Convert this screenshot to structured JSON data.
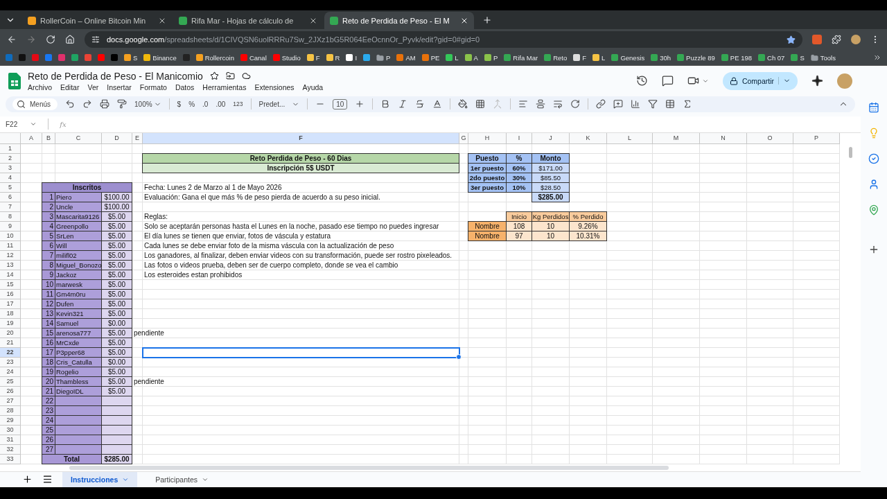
{
  "browser": {
    "tabs": [
      {
        "title": "RollerCoin – Online Bitcoin Min",
        "color": "#f4a020",
        "selected": false
      },
      {
        "title": "Rifa Mar - Hojas de cálculo de",
        "color": "#34a853",
        "selected": false
      },
      {
        "title": "Reto de Perdida de Peso - El M",
        "color": "#34a853",
        "selected": true
      }
    ],
    "url_host": "docs.google.com",
    "url_path": "/spreadsheets/d/1CIVQSN6uolRRRu7Sw_2JXz1bG5R064EeOcnnOr_Pyvk/edit?gid=0#gid=0",
    "bookmarks": [
      {
        "color": "#0f6cbd"
      },
      {
        "color": "#111111"
      },
      {
        "color": "#e50914"
      },
      {
        "color": "#1877f2"
      },
      {
        "color": "#e1306c"
      },
      {
        "color": "#1fa463"
      },
      {
        "color": "#ea4335"
      },
      {
        "color": "#ff0000"
      },
      {
        "color": "#000000"
      },
      {
        "label": "S",
        "color": "#f4a020"
      },
      {
        "label": "Binance",
        "color": "#f0b90b"
      },
      {
        "color": "#222222"
      },
      {
        "label": "Rollercoin",
        "color": "#f4a020"
      },
      {
        "label": "Canal",
        "color": "#ff0000"
      },
      {
        "label": "Studio",
        "color": "#ff0000"
      },
      {
        "label": "F",
        "color": "#f6c344"
      },
      {
        "label": "R",
        "color": "#f6c344"
      },
      {
        "label": "I",
        "color": "#ffffff"
      },
      {
        "color": "#2aabee"
      },
      {
        "label": "P",
        "color": "#9aa0a6",
        "kind": "folder"
      },
      {
        "label": "AM",
        "color": "#e8710a"
      },
      {
        "label": "PE",
        "color": "#e8710a"
      },
      {
        "label": "L",
        "color": "#34c759"
      },
      {
        "label": "A",
        "color": "#8bc34a"
      },
      {
        "label": "P",
        "color": "#8bc34a"
      },
      {
        "label": "Rifa Mar",
        "color": "#34a853"
      },
      {
        "label": "Reto",
        "color": "#34a853"
      },
      {
        "label": "F",
        "color": "#dddddd"
      },
      {
        "label": "L",
        "color": "#f6c344"
      },
      {
        "label": "Genesis",
        "color": "#34a853"
      },
      {
        "label": "30h",
        "color": "#34a853"
      },
      {
        "label": "Puzzle 89",
        "color": "#34a853"
      },
      {
        "label": "PE 198",
        "color": "#34a853"
      },
      {
        "label": "Ch 07",
        "color": "#34a853"
      },
      {
        "label": "S",
        "color": "#34a853"
      },
      {
        "label": "Tools",
        "color": "#9aa0a6",
        "kind": "folder"
      }
    ]
  },
  "doc": {
    "title": "Reto de Perdida de Peso - El Manicomio",
    "menu": [
      "Archivo",
      "Editar",
      "Ver",
      "Insertar",
      "Formato",
      "Datos",
      "Herramientas",
      "Extensiones",
      "Ayuda"
    ],
    "share": "Compartir"
  },
  "toolbar": {
    "search": "Menús",
    "zoom": "100%",
    "currency": "$",
    "percent": "%",
    "decimals_less": ".0",
    "decimals_more": ".00",
    "number_format": "123",
    "font": "Predet...",
    "font_size": "10"
  },
  "name_box": "F22",
  "formula_label": "fx",
  "column_headers": [
    {
      "label": "A",
      "selected": false
    },
    {
      "label": "B",
      "selected": false
    },
    {
      "label": "C",
      "selected": false
    },
    {
      "label": "D",
      "selected": false
    },
    {
      "label": "E",
      "selected": false
    },
    {
      "label": "F",
      "selected": true
    },
    {
      "label": "G",
      "selected": false
    },
    {
      "label": "H",
      "selected": false
    },
    {
      "label": "I",
      "selected": false
    },
    {
      "label": "J",
      "selected": false
    },
    {
      "label": "K",
      "selected": false
    },
    {
      "label": "L",
      "selected": false
    },
    {
      "label": "M",
      "selected": false
    },
    {
      "label": "N",
      "selected": false
    },
    {
      "label": "O",
      "selected": false
    },
    {
      "label": "P",
      "selected": false
    }
  ],
  "row_headers": [
    {
      "label": "1",
      "selected": false
    },
    {
      "label": "2",
      "selected": false
    },
    {
      "label": "3",
      "selected": false
    },
    {
      "label": "4",
      "selected": false
    },
    {
      "label": "5",
      "selected": false
    },
    {
      "label": "6",
      "selected": false
    },
    {
      "label": "7",
      "selected": false
    },
    {
      "label": "8",
      "selected": false
    },
    {
      "label": "9",
      "selected": false
    },
    {
      "label": "10",
      "selected": false
    },
    {
      "label": "11",
      "selected": false
    },
    {
      "label": "12",
      "selected": false
    },
    {
      "label": "13",
      "selected": false
    },
    {
      "label": "14",
      "selected": false
    },
    {
      "label": "15",
      "selected": false
    },
    {
      "label": "16",
      "selected": false
    },
    {
      "label": "17",
      "selected": false
    },
    {
      "label": "18",
      "selected": false
    },
    {
      "label": "19",
      "selected": false
    },
    {
      "label": "20",
      "selected": false
    },
    {
      "label": "21",
      "selected": false
    },
    {
      "label": "22",
      "selected": true
    },
    {
      "label": "23",
      "selected": false
    },
    {
      "label": "24",
      "selected": false
    },
    {
      "label": "25",
      "selected": false
    },
    {
      "label": "26",
      "selected": false
    },
    {
      "label": "27",
      "selected": false
    },
    {
      "label": "28",
      "selected": false
    },
    {
      "label": "29",
      "selected": false
    },
    {
      "label": "30",
      "selected": false
    },
    {
      "label": "31",
      "selected": false
    },
    {
      "label": "32",
      "selected": false
    },
    {
      "label": "33",
      "selected": false
    }
  ],
  "title_block": [
    "Reto Perdida de Peso - 60 Dias",
    "Inscripción 5$ USDT"
  ],
  "info": [
    "Fecha: Lunes 2 de Marzo al 1 de Mayo 2026",
    "Evaluación: Gana el que más % de peso pierda de acuerdo a su peso inicial."
  ],
  "rules_heading": "Reglas:",
  "rules": [
    "Solo se aceptarán personas hasta el Lunes en la noche, pasado ese tiempo no puedes ingresar",
    "El día lunes se tienen que enviar, fotos de váscula y estatura",
    "Cada lunes se debe enviar foto de la misma váscula con la actualización de peso",
    "Los ganadores, al finalizar, deben enviar videos con su transformación, puede ser rostro pixeleados.",
    "Las fotos o videos prueba, deben ser de cuerpo completo, donde se vea el cambio",
    "Los esteroides estan prohibidos"
  ],
  "inscritos": {
    "header": "Inscritos",
    "rows": [
      {
        "number": "1",
        "name": "Piero",
        "amount": "$100.00"
      },
      {
        "number": "2",
        "name": "Uncle",
        "amount": "$100.00"
      },
      {
        "number": "3",
        "name": "Mascarita9126",
        "amount": "$5.00"
      },
      {
        "number": "4",
        "name": "Greenpollo",
        "amount": "$5.00"
      },
      {
        "number": "5",
        "name": "SrLen",
        "amount": "$5.00"
      },
      {
        "number": "6",
        "name": "Will",
        "amount": "$5.00"
      },
      {
        "number": "7",
        "name": "milifl02",
        "amount": "$5.00"
      },
      {
        "number": "8",
        "name": "Miguel_Bonozo",
        "amount": "$5.00"
      },
      {
        "number": "9",
        "name": "Jackoz",
        "amount": "$5.00"
      },
      {
        "number": "10",
        "name": "marwesk",
        "amount": "$5.00"
      },
      {
        "number": "11",
        "name": "Gm4m0ru",
        "amount": "$5.00"
      },
      {
        "number": "12",
        "name": "Dufen",
        "amount": "$5.00"
      },
      {
        "number": "13",
        "name": "Kevin321",
        "amount": "$5.00"
      },
      {
        "number": "14",
        "name": "Samuel",
        "amount": "$0.00"
      },
      {
        "number": "15",
        "name": "arenosa777",
        "amount": "$5.00",
        "note": "pendiente"
      },
      {
        "number": "16",
        "name": "MrCxde",
        "amount": "$5.00"
      },
      {
        "number": "17",
        "name": "P3pper68",
        "amount": "$5.00"
      },
      {
        "number": "18",
        "name": "Cris_Catulla",
        "amount": "$0.00"
      },
      {
        "number": "19",
        "name": "Rogelio",
        "amount": "$5.00"
      },
      {
        "number": "20",
        "name": "Thambless",
        "amount": "$5.00",
        "note": "pendiente"
      },
      {
        "number": "21",
        "name": "DiegoIDL",
        "amount": "$5.00"
      },
      {
        "number": "22"
      },
      {
        "number": "23"
      },
      {
        "number": "24"
      },
      {
        "number": "25"
      },
      {
        "number": "26"
      },
      {
        "number": "27"
      }
    ],
    "total_label": "Total",
    "total": "$285.00"
  },
  "prizes": {
    "columns": [
      "Puesto",
      "%",
      "Monto"
    ],
    "rows": [
      [
        "1er puesto",
        "60%",
        "$171.00"
      ],
      [
        "2do puesto",
        "30%",
        "$85.50"
      ],
      [
        "3er puesto",
        "10%",
        "$28.50"
      ]
    ],
    "total": "$285.00"
  },
  "progress": {
    "columns": [
      "Inicio",
      "Kg Perdidos",
      "% Perdido"
    ],
    "rows": [
      {
        "label": "Nombre",
        "values": [
          "108",
          "10",
          "9.26%"
        ]
      },
      {
        "label": "Nombre",
        "values": [
          "97",
          "10",
          "10.31%"
        ]
      }
    ]
  },
  "sheet_tabs": [
    {
      "label": "Instrucciones",
      "selected": true
    },
    {
      "label": "Participantes",
      "selected": false
    }
  ]
}
